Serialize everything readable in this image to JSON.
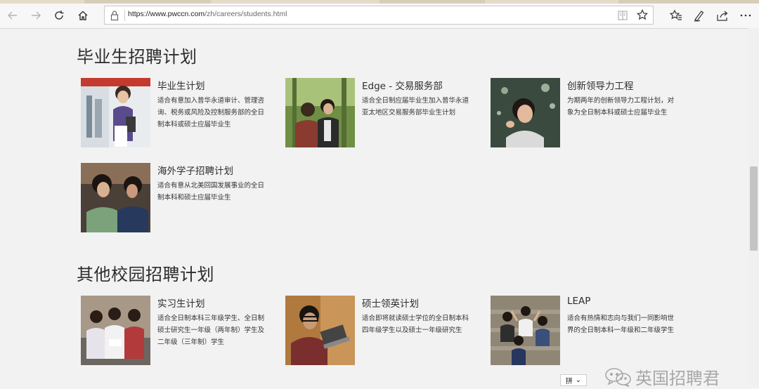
{
  "browser": {
    "url_host": "https://www.pwccn.com",
    "url_path": "/zh/careers/students.html",
    "icons": [
      "back-icon",
      "forward-icon",
      "refresh-icon",
      "home-icon",
      "lock-icon",
      "reading-view-icon",
      "favorite-star-icon",
      "favorites-hub-icon",
      "web-note-icon",
      "share-icon",
      "more-icon"
    ]
  },
  "sections": [
    {
      "title": "毕业生招聘计划",
      "cards": [
        {
          "title": "毕业生计划",
          "desc": "适合有意加入普华永道审计、管理咨询、税务或风险及控制服务部的全日制本科或硕士应届毕业生"
        },
        {
          "title": "Edge - 交易服务部",
          "desc": "适合全日制应届毕业生加入普华永道亚太地区交易服务部毕业生计划"
        },
        {
          "title": "创新领导力工程",
          "desc": "为期两年的创新领导力工程计划，对象为全日制本科或硕士应届毕业生"
        },
        {
          "title": "海外学子招聘计划",
          "desc": "适合有意从北美回国发展事业的全日制本科和硕士应届毕业生"
        }
      ]
    },
    {
      "title": "其他校园招聘计划",
      "cards": [
        {
          "title": "实习生计划",
          "desc": "适合全日制本科三年级学生、全日制硕士研究生一年级（两年制）学生及二年级（三年制）学生"
        },
        {
          "title": "硕士领英计划",
          "desc": "适合即将就读硕士学位的全日制本科四年级学生以及硕士一年级研究生"
        },
        {
          "title": "LEAP",
          "desc": "适合有热情和志向与我们一同影响世界的全日制本科一年级和二年级学生"
        }
      ]
    }
  ],
  "ime": {
    "label": "拼",
    "arrow": "⌄"
  },
  "watermark": {
    "text": "英国招聘君"
  }
}
